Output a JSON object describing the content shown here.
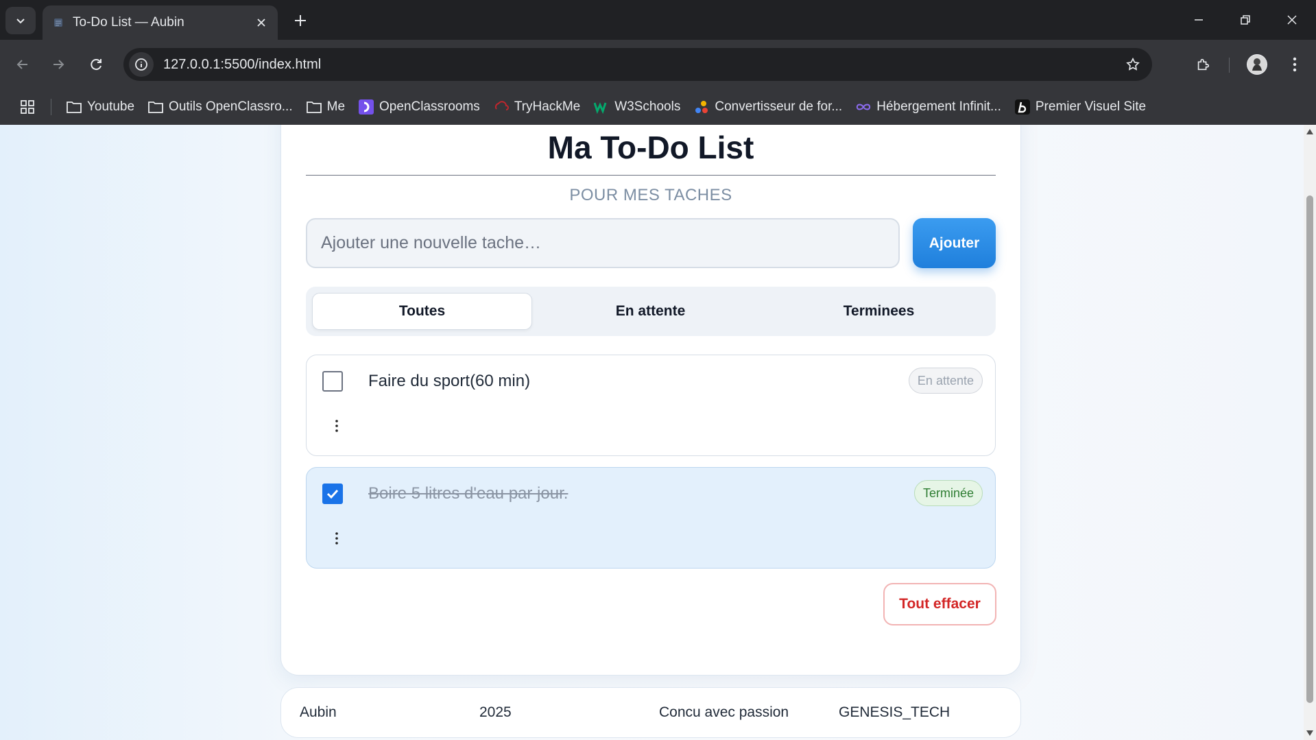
{
  "browser": {
    "tab_title": "To-Do List — Aubin",
    "url": "127.0.0.1:5500/index.html",
    "bookmarks": [
      {
        "label": "Youtube",
        "icon": "folder-icon"
      },
      {
        "label": "Outils OpenClassro...",
        "icon": "folder-icon"
      },
      {
        "label": "Me",
        "icon": "folder-icon"
      },
      {
        "label": "OpenClassrooms",
        "icon": "openclassrooms-icon"
      },
      {
        "label": "TryHackMe",
        "icon": "tryhackme-icon"
      },
      {
        "label": "W3Schools",
        "icon": "w3schools-icon"
      },
      {
        "label": "Convertisseur de for...",
        "icon": "convertisseur-icon"
      },
      {
        "label": "Hébergement Infinit...",
        "icon": "infinity-icon"
      },
      {
        "label": "Premier Visuel Site",
        "icon": "bold-b-icon"
      }
    ]
  },
  "app": {
    "title": "Ma To-Do List",
    "subtitle": "POUR MES TACHES",
    "input_placeholder": "Ajouter une nouvelle tache…",
    "add_label": "Ajouter",
    "filters": [
      "Toutes",
      "En attente",
      "Terminees"
    ],
    "active_filter": "Toutes",
    "tasks": [
      {
        "text": "Faire du sport(60 min)",
        "done": false,
        "status": "En attente"
      },
      {
        "text": "Boire 5 litres d'eau par jour.",
        "done": true,
        "status": "Terminée"
      }
    ],
    "clear_label": "Tout effacer"
  },
  "footer": {
    "author": "Aubin",
    "year": "2025",
    "tagline": "Concu avec passion",
    "brand": "GENESIS_TECH"
  },
  "colors": {
    "accent": "#1f7fdc",
    "danger": "#d32626",
    "done_bg": "#e3f0fc",
    "chrome_dark": "#202124"
  }
}
